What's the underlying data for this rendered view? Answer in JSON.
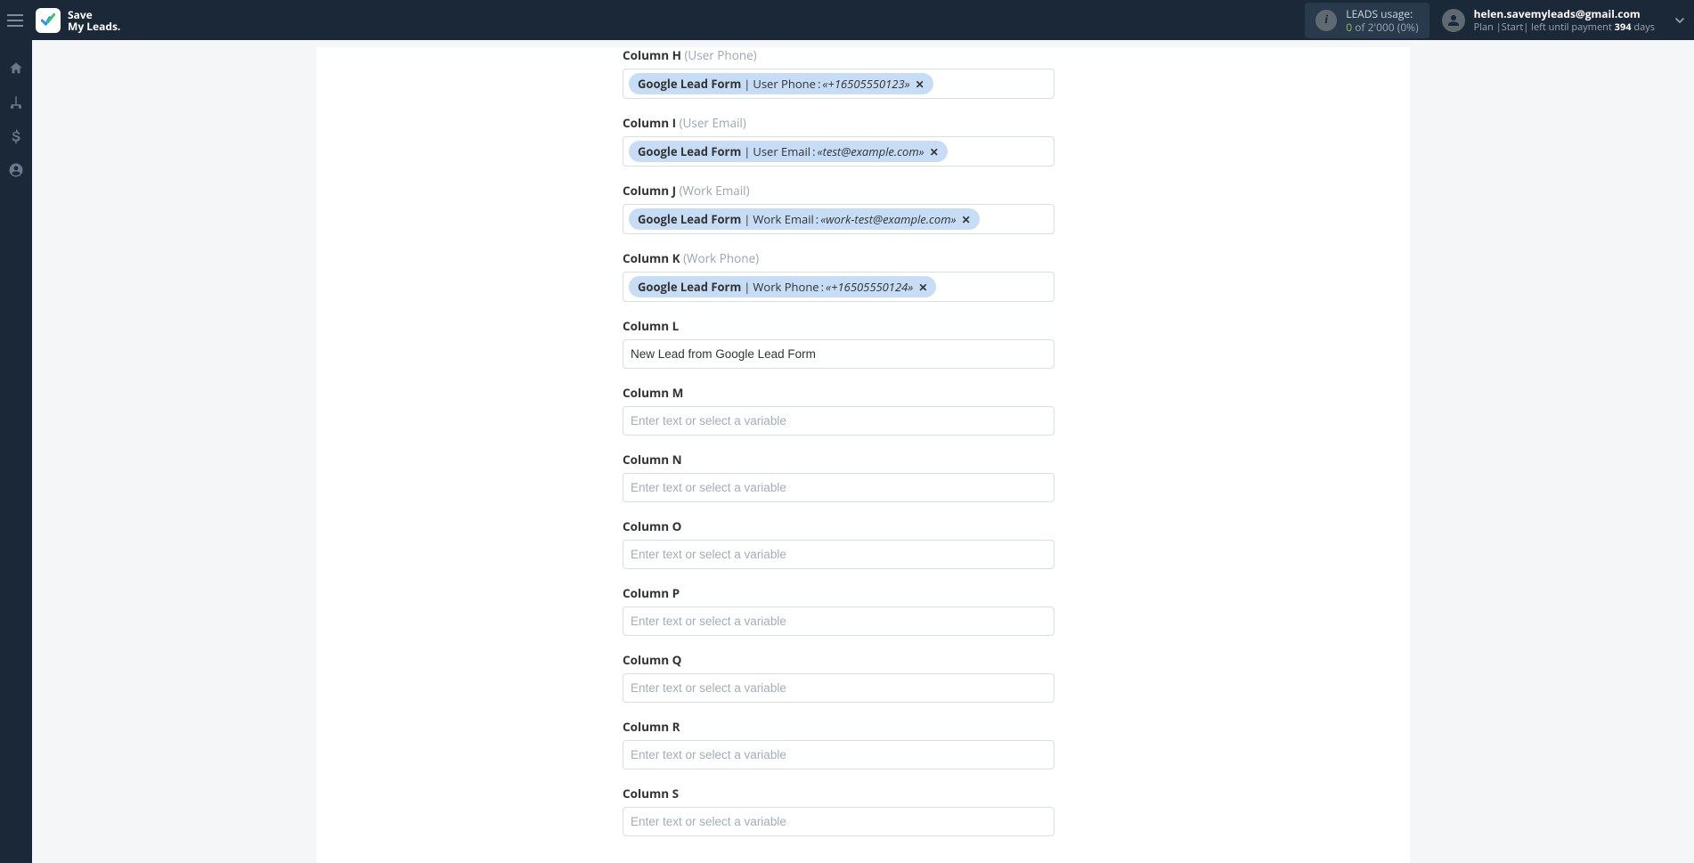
{
  "brand": {
    "line1": "Save",
    "line2": "My Leads."
  },
  "header": {
    "usage_label": "LEADS usage:",
    "usage_value": "0",
    "usage_of": " of 2'000 (0%)",
    "user_email": "helen.savemyleads@gmail.com",
    "plan_prefix": "Plan |Start|  left until payment ",
    "plan_days_num": "394",
    "plan_days_suffix": " days"
  },
  "form": {
    "placeholder": "Enter text or select a variable",
    "chip_source": "Google Lead Form",
    "fields": [
      {
        "key": "h",
        "label": "Column H",
        "hint": "(User Phone)",
        "chip_field": "User Phone",
        "chip_sample": "«+16505550123»"
      },
      {
        "key": "i",
        "label": "Column I",
        "hint": "(User Email)",
        "chip_field": "User Email",
        "chip_sample": "«test@example.com»"
      },
      {
        "key": "j",
        "label": "Column J",
        "hint": "(Work Email)",
        "chip_field": "Work Email",
        "chip_sample": "«work-test@example.com»"
      },
      {
        "key": "k",
        "label": "Column K",
        "hint": "(Work Phone)",
        "chip_field": "Work Phone",
        "chip_sample": "«+16505550124»"
      },
      {
        "key": "l",
        "label": "Column L",
        "hint": "",
        "text_value": "New Lead from Google Lead Form"
      },
      {
        "key": "m",
        "label": "Column M",
        "hint": ""
      },
      {
        "key": "n",
        "label": "Column N",
        "hint": ""
      },
      {
        "key": "o",
        "label": "Column O",
        "hint": ""
      },
      {
        "key": "p",
        "label": "Column P",
        "hint": ""
      },
      {
        "key": "q",
        "label": "Column Q",
        "hint": ""
      },
      {
        "key": "r",
        "label": "Column R",
        "hint": ""
      },
      {
        "key": "s",
        "label": "Column S",
        "hint": ""
      }
    ]
  }
}
